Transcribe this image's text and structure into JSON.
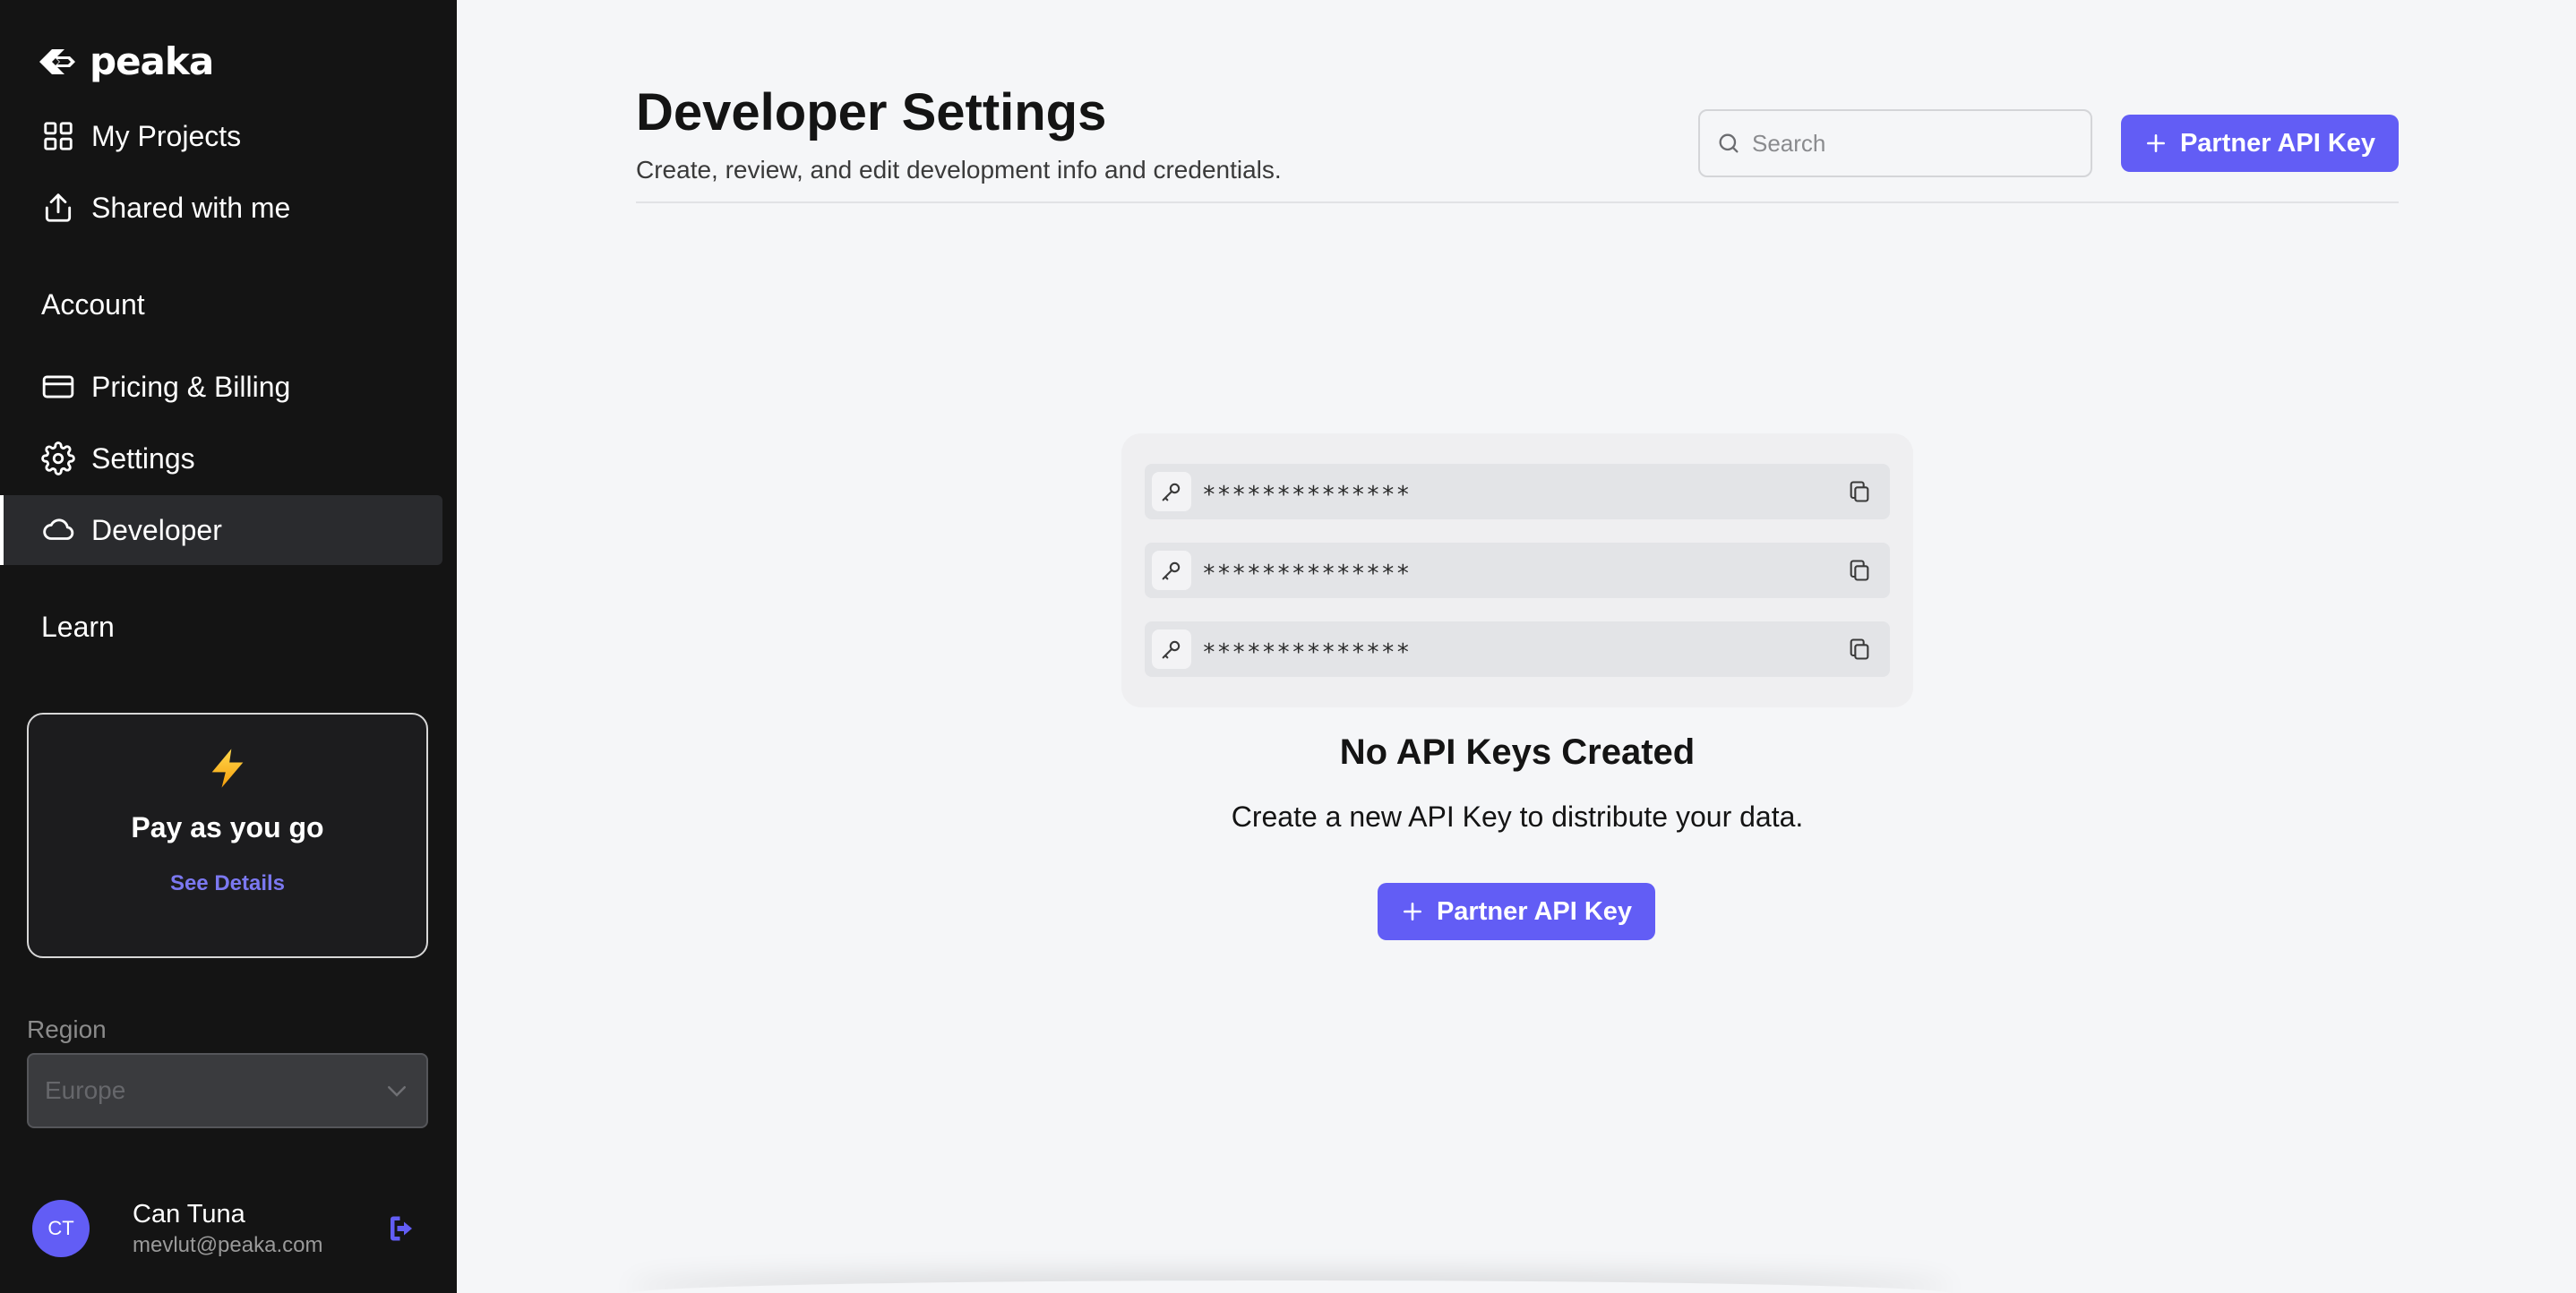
{
  "brand": {
    "name": "peaka"
  },
  "sidebar": {
    "nav": [
      {
        "label": "My Projects",
        "icon": "grid-icon"
      },
      {
        "label": "Shared with me",
        "icon": "share-icon"
      }
    ],
    "account_heading": "Account",
    "account_items": [
      {
        "label": "Pricing & Billing",
        "icon": "credit-card-icon"
      },
      {
        "label": "Settings",
        "icon": "gear-icon"
      },
      {
        "label": "Developer",
        "icon": "cloud-icon",
        "active": true
      }
    ],
    "learn_heading": "Learn",
    "plan": {
      "title": "Pay as you go",
      "link": "See Details",
      "icon": "lightning-icon"
    },
    "region": {
      "label": "Region",
      "value": "Europe"
    },
    "user": {
      "initials": "CT",
      "name": "Can Tuna",
      "email": "mevlut@peaka.com"
    }
  },
  "header": {
    "title": "Developer Settings",
    "subtitle": "Create, review, and edit development info and credentials.",
    "search_placeholder": "Search",
    "button_label": "Partner API Key"
  },
  "empty_state": {
    "keys": [
      "**************",
      "**************",
      "**************"
    ],
    "title": "No API Keys Created",
    "description": "Create a new API Key to distribute your data.",
    "button_label": "Partner API Key"
  },
  "colors": {
    "accent": "#625df5",
    "sidebar_bg": "#141414",
    "page_bg": "#f5f6f8"
  }
}
